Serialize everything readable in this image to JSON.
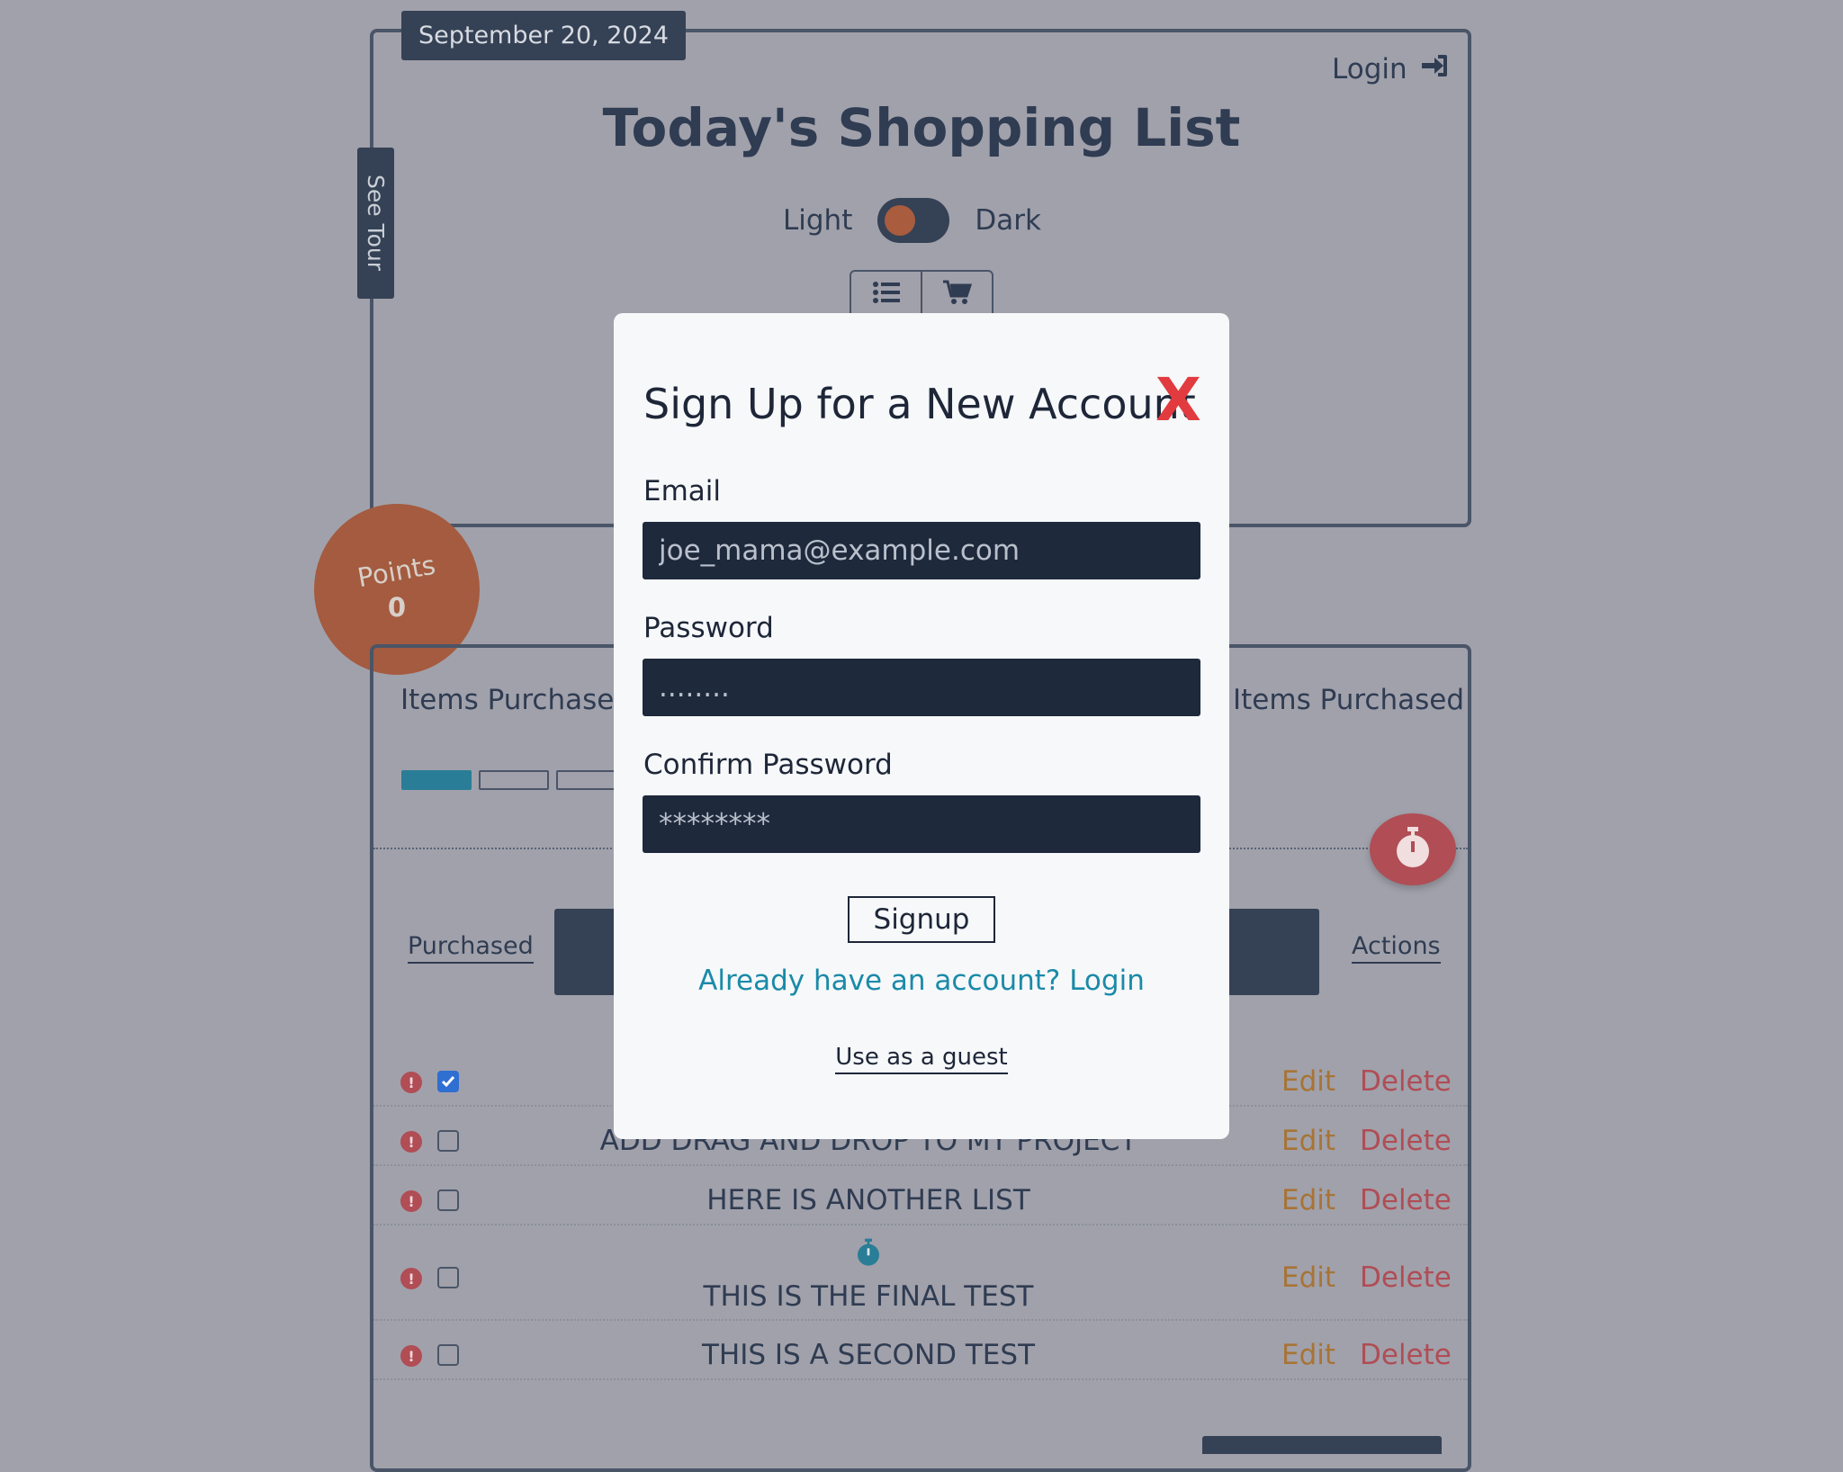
{
  "header": {
    "date": "September 20, 2024",
    "login_label": "Login",
    "title": "Today's Shopping List",
    "theme_light": "Light",
    "theme_dark": "Dark"
  },
  "sidebar": {
    "tour_label": "See Tour"
  },
  "points": {
    "label": "Points",
    "value": "0"
  },
  "progress": {
    "left_label": "Items Purchased",
    "right_label": "Items Purchased",
    "segments_filled": 1
  },
  "table": {
    "col_purchased": "Purchased",
    "col_actions": "Actions",
    "rows": [
      {
        "name": "",
        "checked": true,
        "edit": "Edit",
        "delete": "Delete"
      },
      {
        "name": "ADD DRAG AND DROP TO MY PROJECT",
        "checked": false,
        "edit": "Edit",
        "delete": "Delete"
      },
      {
        "name": "HERE IS ANOTHER LIST",
        "checked": false,
        "edit": "Edit",
        "delete": "Delete"
      },
      {
        "name": "THIS IS THE FINAL TEST",
        "checked": false,
        "edit": "Edit",
        "delete": "Delete"
      },
      {
        "name": "THIS IS A SECOND TEST",
        "checked": false,
        "edit": "Edit",
        "delete": "Delete"
      }
    ]
  },
  "modal": {
    "title": "Sign Up for a New Account",
    "close_label": "X",
    "email_label": "Email",
    "email_placeholder": "joe_mama@example.com",
    "password_label": "Password",
    "password_placeholder": "........",
    "confirm_label": "Confirm Password",
    "confirm_placeholder": "********",
    "signup_label": "Signup",
    "login_switch": "Already have an account? Login",
    "guest_label": "Use as a guest"
  },
  "colors": {
    "accent_orange": "#a45b3f",
    "alert_red": "#b04d55",
    "link_teal": "#1a8aa8",
    "close_red": "#e23b3f"
  }
}
